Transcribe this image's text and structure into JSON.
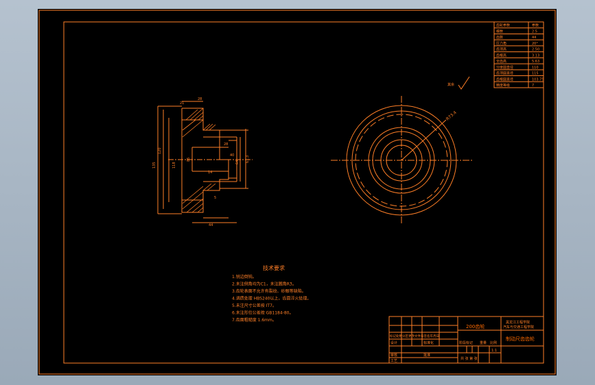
{
  "colors": {
    "background": "#000000",
    "line": "#ff7f27",
    "title_text": "#ff6a00",
    "viewport": "#a7b5c4"
  },
  "params": {
    "rows": [
      {
        "label": "齿轮参数",
        "value": "参数"
      },
      {
        "label": "模数",
        "value": "2.5"
      },
      {
        "label": "齿数",
        "value": "44"
      },
      {
        "label": "压力角",
        "value": "20°"
      },
      {
        "label": "齿顶高",
        "value": "2.50"
      },
      {
        "label": "齿根高",
        "value": "3.13"
      },
      {
        "label": "全齿高",
        "value": "5.63"
      },
      {
        "label": "分度圆直径",
        "value": "110"
      },
      {
        "label": "齿顶圆直径",
        "value": "115"
      },
      {
        "label": "齿根圆直径",
        "value": "103.75"
      },
      {
        "label": "精度等级",
        "value": "7"
      }
    ]
  },
  "roughness_note": "其余",
  "section_view": {
    "dims": {
      "top_a": "21",
      "top_b": "28",
      "left_outer": "135",
      "left_mid": "120",
      "left_inner": "118",
      "bore_a": "85",
      "bore_b": "64",
      "bore_c": "61.3",
      "hub_a": "28",
      "hub_b": "40",
      "bottom": "44",
      "small_a": "14",
      "small_b": "5"
    }
  },
  "front_view": {
    "radius_label": "R73.4"
  },
  "tech": {
    "title": "技术要求",
    "items": [
      "1.锐边倒钝。",
      "2.未注倒角均为C1，未注圆角R3。",
      "3.齿轮表面不允许有裂纹、砂眼等缺陷。",
      "4.调质处理 HBS240以上，齿面淬火处理。",
      "5.未注尺寸公差按 IT7。",
      "6.未注形位公差按 GB1184-80。",
      "7.齿面粗糙度 1.6mm。"
    ]
  },
  "title_block": {
    "drawing_no": "200齿轮",
    "school_1": "黑龙江工程学院",
    "school_2": "汽车与交通工程学院",
    "part_name": "制动尺齿齿轮",
    "designer": "设计",
    "checker": "审核",
    "process": "工艺",
    "standard": "标准化",
    "approve": "批准",
    "stage_mark": "阶段标记",
    "weight": "重量",
    "scale_label": "比例",
    "scale": "1:1",
    "sheet_info": "共 张 第 张",
    "change_row": "标记处数分区更改文件号签名年月日"
  }
}
